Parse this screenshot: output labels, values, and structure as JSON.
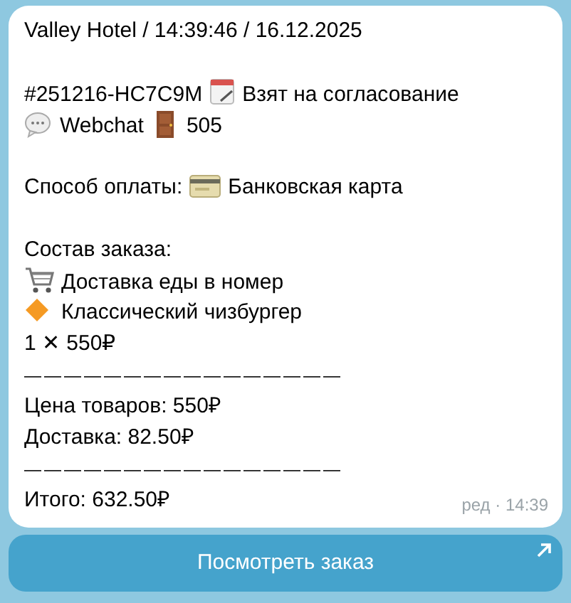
{
  "header": "Valley Hotel / 14:39:46 / 16.12.2025",
  "order": {
    "number": "#251216-HC7C9M",
    "status": "Взят на согласование",
    "channel": "Webchat",
    "room": "505"
  },
  "payment": {
    "label": "Способ оплаты:",
    "method": "Банковская карта"
  },
  "items": {
    "heading": "Состав заказа:",
    "category": "Доставка еды в номер",
    "product": "Классический чизбургер",
    "quantity": "1 ✕ 550₽"
  },
  "separators": [
    "————————————————",
    "————————————————"
  ],
  "totals": {
    "goods": "Цена товаров: 550₽",
    "delivery": "Доставка: 82.50₽",
    "total": "Итого: 632.50₽"
  },
  "meta": {
    "edited": "ред",
    "dot": "·",
    "time": "14:39"
  },
  "button": {
    "label": "Посмотреть заказ"
  }
}
